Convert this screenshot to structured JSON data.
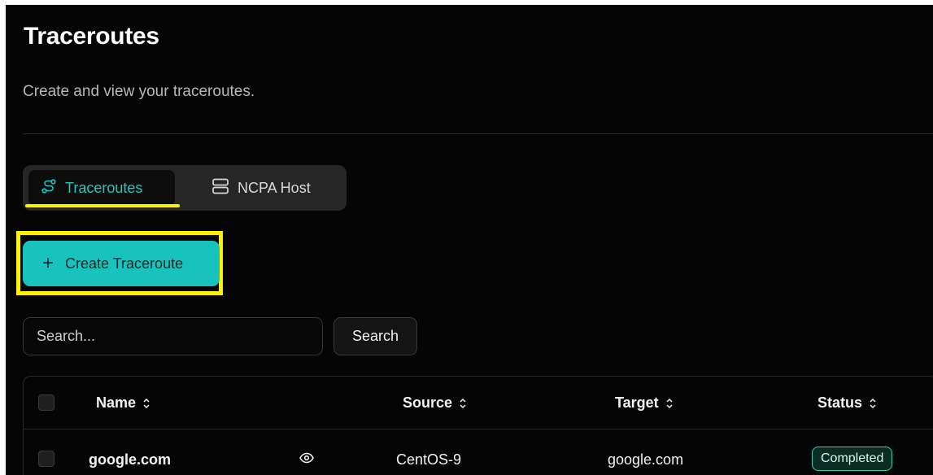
{
  "page": {
    "title": "Traceroutes",
    "subtitle": "Create and view your traceroutes."
  },
  "tabs": [
    {
      "label": "Traceroutes",
      "icon": "route-icon",
      "active": true
    },
    {
      "label": "NCPA Host",
      "icon": "server-icon",
      "active": false
    }
  ],
  "actions": {
    "create_label": "Create Traceroute",
    "search_placeholder": "Search...",
    "search_label": "Search"
  },
  "table": {
    "columns": [
      "Name",
      "Source",
      "Target",
      "Status"
    ],
    "rows": [
      {
        "name": "google.com",
        "source": "CentOS-9",
        "target": "google.com",
        "status": "Completed"
      }
    ]
  },
  "colors": {
    "accent": "#19c3bd",
    "highlight": "#fff200",
    "background": "#050505",
    "status_completed": "#2bd3b3"
  }
}
